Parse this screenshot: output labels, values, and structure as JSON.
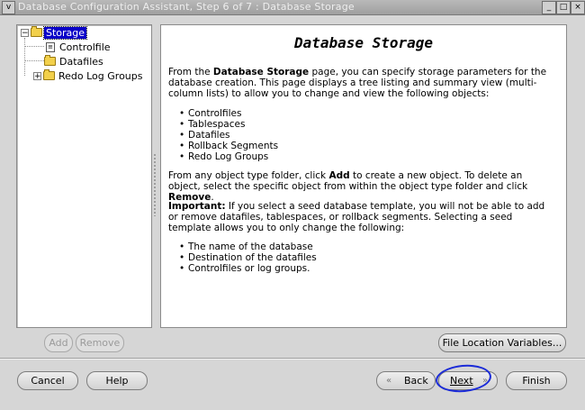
{
  "window": {
    "title": "Database Configuration Assistant, Step 6 of 7 : Database Storage",
    "sys_glyph": "v",
    "min_glyph": "_",
    "max_glyph": "□",
    "close_glyph": "×"
  },
  "tree": {
    "items": [
      {
        "label": "Storage",
        "selected": true,
        "expander": "−"
      },
      {
        "label": "Controlfile",
        "icon_glyph": "≡"
      },
      {
        "label": "Datafiles"
      },
      {
        "label": "Redo Log Groups",
        "expander": "+"
      }
    ]
  },
  "content": {
    "heading": "Database Storage",
    "intro": {
      "pre": "From the ",
      "bold": "Database Storage",
      "post": " page, you can specify storage parameters for the database creation. This page displays a tree listing and summary view (multi-column lists) to allow you to change and view the following objects:"
    },
    "objects": [
      "Controlfiles",
      "Tablespaces",
      "Datafiles",
      "Rollback Segments",
      "Redo Log Groups"
    ],
    "add_remove": {
      "pre": "From any object type folder, click ",
      "add": "Add",
      "mid": " to create a new object. To delete an object, select the specific object from within the object type folder and click ",
      "remove": "Remove",
      "post": "."
    },
    "important": {
      "label": "Important:",
      "text": " If you select a seed database template, you will not be able to add or remove datafiles, tablespaces, or rollback segments. Selecting a seed template allows you to only change the following:"
    },
    "changeable": [
      "The name of the database",
      "Destination of the datafiles",
      "Controlfiles or log groups."
    ]
  },
  "buttons": {
    "add": "Add",
    "remove": "Remove",
    "file_location": "File Location Variables...",
    "cancel": "Cancel",
    "help": "Help",
    "back": "Back",
    "next": "Next",
    "finish": "Finish",
    "back_arrow": "«",
    "next_arrow": "»"
  }
}
